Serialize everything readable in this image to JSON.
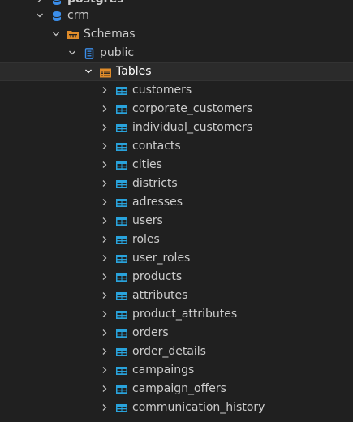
{
  "tree": {
    "postgres": {
      "label": "postgres",
      "icon": "database-icon",
      "color": "#3b8eea"
    },
    "crm": {
      "label": "crm",
      "icon": "database-icon",
      "color": "#3b8eea"
    },
    "schemas": {
      "label": "Schemas",
      "icon": "folder-schema-icon",
      "color": "#e08c2a"
    },
    "public": {
      "label": "public",
      "icon": "schema-icon",
      "color": "#3b8eea"
    },
    "tables": {
      "label": "Tables",
      "icon": "tables-folder-icon",
      "color": "#e08c2a",
      "selected": true
    },
    "table_icon": "table-icon",
    "table_icon_color": "#29a3dc",
    "items": [
      {
        "label": "customers"
      },
      {
        "label": "corporate_customers"
      },
      {
        "label": "individual_customers"
      },
      {
        "label": "contacts"
      },
      {
        "label": "cities"
      },
      {
        "label": "districts"
      },
      {
        "label": "adresses"
      },
      {
        "label": "users"
      },
      {
        "label": "roles"
      },
      {
        "label": "user_roles"
      },
      {
        "label": "products"
      },
      {
        "label": "attributes"
      },
      {
        "label": "product_attributes"
      },
      {
        "label": "orders"
      },
      {
        "label": "order_details"
      },
      {
        "label": "campaings"
      },
      {
        "label": "campaign_offers"
      },
      {
        "label": "communication_history"
      }
    ]
  },
  "colors": {
    "background": "#202020",
    "text": "#cccccc",
    "chevron": "#c5c5c5",
    "selected_bg": "#2b2b2b"
  }
}
